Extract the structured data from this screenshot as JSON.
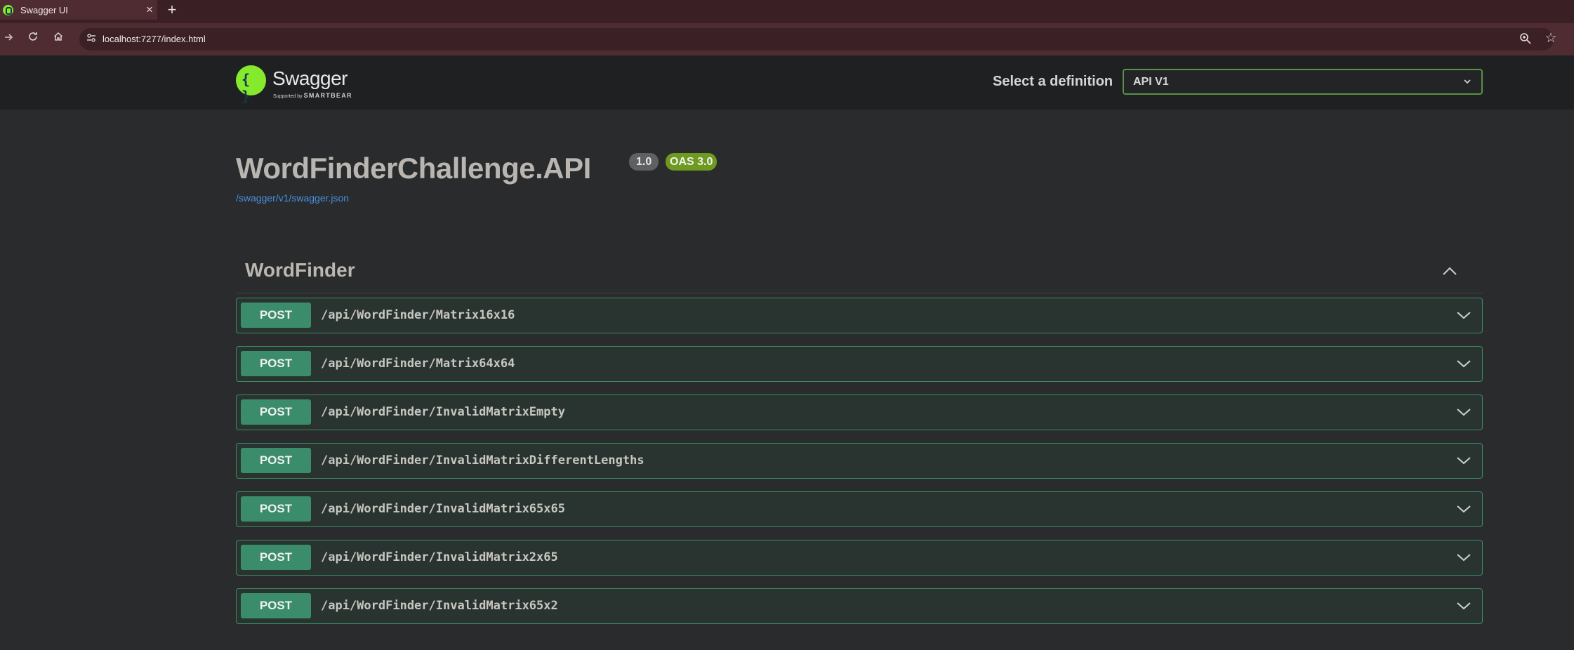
{
  "browser": {
    "tab_title": "Swagger UI",
    "tab_close": "×",
    "new_tab": "+",
    "url": "localhost:7277/index.html"
  },
  "swagger": {
    "logo_name": "Swagger",
    "logo_supported_by": "Supported by",
    "logo_brand": "SMARTBEAR",
    "definition_label": "Select a definition",
    "definition_value": "API V1"
  },
  "info": {
    "title": "WordFinderChallenge.API",
    "version": "1.0",
    "oas": "OAS 3.0",
    "spec_link": "/swagger/v1/swagger.json"
  },
  "tag": {
    "name": "WordFinder",
    "expanded": true
  },
  "operations": [
    {
      "method": "POST",
      "path": "/api/WordFinder/Matrix16x16"
    },
    {
      "method": "POST",
      "path": "/api/WordFinder/Matrix64x64"
    },
    {
      "method": "POST",
      "path": "/api/WordFinder/InvalidMatrixEmpty"
    },
    {
      "method": "POST",
      "path": "/api/WordFinder/InvalidMatrixDifferentLengths"
    },
    {
      "method": "POST",
      "path": "/api/WordFinder/InvalidMatrix65x65"
    },
    {
      "method": "POST",
      "path": "/api/WordFinder/InvalidMatrix2x65"
    },
    {
      "method": "POST",
      "path": "/api/WordFinder/InvalidMatrix65x2"
    }
  ],
  "colors": {
    "post_method": "#3a8c6b",
    "post_border": "#3c8a63",
    "swagger_green": "#85ea2d",
    "link": "#4a8fe0"
  }
}
